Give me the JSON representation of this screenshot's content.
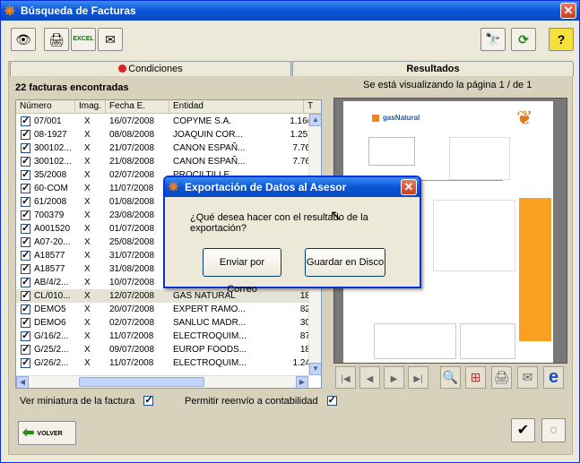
{
  "window": {
    "title": "Búsqueda de Facturas",
    "close": "✕"
  },
  "toolbar": {
    "view": "👁",
    "print": "🖨",
    "excel": "EXCEL",
    "export": "✉",
    "binoculars": "🔭",
    "refresh": "⟳",
    "help": "?"
  },
  "tabs": {
    "conditions": "Condiciones",
    "results": "Resultados"
  },
  "results": {
    "count_label": "22 facturas encontradas",
    "page_info": "Se está visualizando la página 1 / de 1",
    "columns": [
      "Número",
      "Imag.",
      "Fecha E.",
      "Entidad",
      "T"
    ],
    "rows": [
      {
        "num": "07/001",
        "img": "X",
        "fecha": "16/07/2008",
        "entidad": "COPYME S.A.",
        "total": "1.16("
      },
      {
        "num": "08-1927",
        "img": "X",
        "fecha": "08/08/2008",
        "entidad": "JOAQUIN COR...",
        "total": "1.25:"
      },
      {
        "num": "300102...",
        "img": "X",
        "fecha": "21/07/2008",
        "entidad": "CANON ESPAÑ...",
        "total": "7.76"
      },
      {
        "num": "300102...",
        "img": "X",
        "fecha": "21/08/2008",
        "entidad": "CANON ESPAÑ...",
        "total": "7.76"
      },
      {
        "num": "35/2008",
        "img": "X",
        "fecha": "02/07/2008",
        "entidad": "PROCILTILLE",
        "total": ""
      },
      {
        "num": "60-COM",
        "img": "X",
        "fecha": "11/07/2008",
        "entidad": "",
        "total": ""
      },
      {
        "num": "61/2008",
        "img": "X",
        "fecha": "01/08/2008",
        "entidad": "",
        "total": ""
      },
      {
        "num": "700379",
        "img": "X",
        "fecha": "23/08/2008",
        "entidad": "",
        "total": ""
      },
      {
        "num": "A001520",
        "img": "X",
        "fecha": "01/07/2008",
        "entidad": "",
        "total": ""
      },
      {
        "num": "A07-20...",
        "img": "X",
        "fecha": "25/08/2008",
        "entidad": "",
        "total": ""
      },
      {
        "num": "A18577",
        "img": "X",
        "fecha": "31/07/2008",
        "entidad": "",
        "total": ""
      },
      {
        "num": "A18577",
        "img": "X",
        "fecha": "31/08/2008",
        "entidad": "",
        "total": ""
      },
      {
        "num": "AB/4/2...",
        "img": "X",
        "fecha": "10/07/2008",
        "entidad": "",
        "total": ""
      },
      {
        "num": "CL/010...",
        "img": "X",
        "fecha": "12/07/2008",
        "entidad": "GAS NATURAL",
        "total": "18"
      },
      {
        "num": "DEMO5",
        "img": "X",
        "fecha": "20/07/2008",
        "entidad": "EXPERT RAMO...",
        "total": "82"
      },
      {
        "num": "DEMO6",
        "img": "X",
        "fecha": "02/07/2008",
        "entidad": "SANLUC MADR...",
        "total": "30"
      },
      {
        "num": "G/16/2...",
        "img": "X",
        "fecha": "11/07/2008",
        "entidad": "ELECTROQUIM...",
        "total": "87"
      },
      {
        "num": "G/25/2...",
        "img": "X",
        "fecha": "09/07/2008",
        "entidad": "EUROP FOODS...",
        "total": "18"
      },
      {
        "num": "G/26/2...",
        "img": "X",
        "fecha": "11/07/2008",
        "entidad": "ELECTROQUIM...",
        "total": "1.24"
      }
    ]
  },
  "options": {
    "thumbnail": "Ver miniatura de la factura",
    "resend": "Permitir reenvío a contabilidad"
  },
  "preview": {
    "brand": "gasNatural"
  },
  "nav": {
    "first": "|◀",
    "prev": "◀",
    "next": "▶",
    "last": "▶|",
    "zoom": "🔍",
    "grid": "⊞",
    "print": "🖨",
    "send": "✉",
    "ie": "e"
  },
  "footer": {
    "back": "VOLVER",
    "ok": "✔",
    "circle": "○"
  },
  "dialog": {
    "title": "Exportación de Datos al Asesor",
    "close": "✕",
    "message": "¿Qué desea hacer con el resultado de la exportación?",
    "btn_email": "Enviar por Correo",
    "btn_disk": "Guardar en Disco"
  }
}
